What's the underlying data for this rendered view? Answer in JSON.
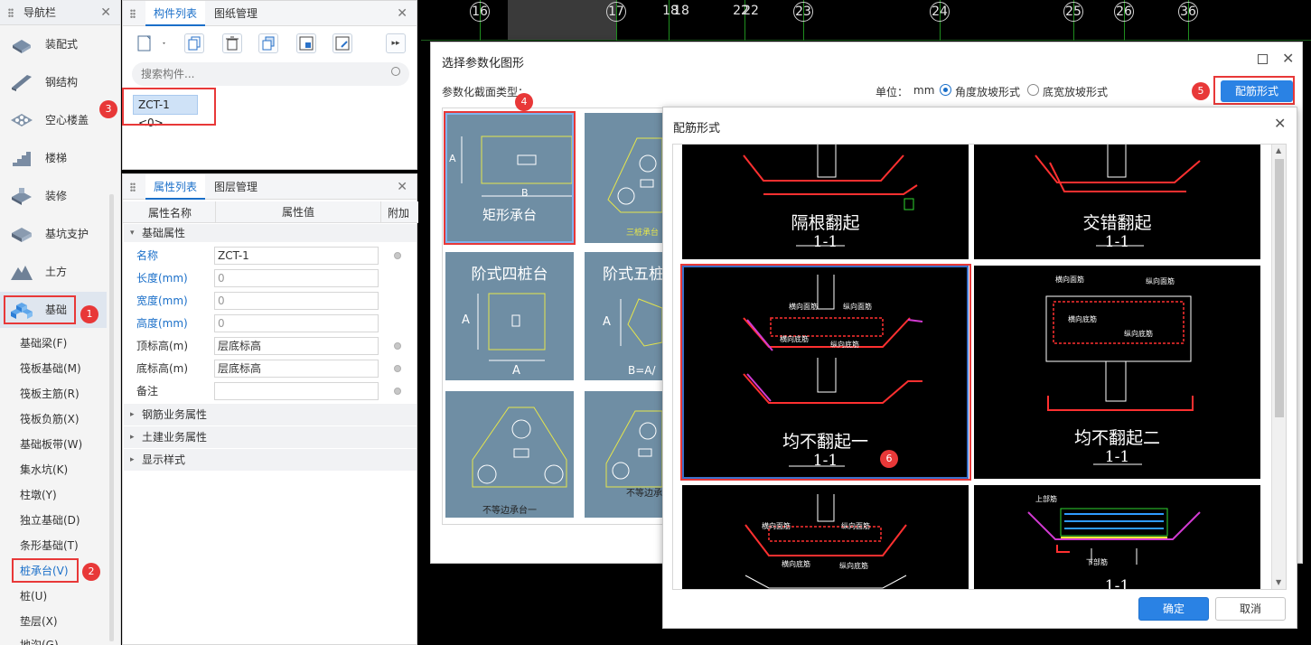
{
  "nav": {
    "title": "导航栏",
    "categories": [
      "装配式",
      "钢结构",
      "空心楼盖",
      "楼梯",
      "装修",
      "基坑支护",
      "土方",
      "基础"
    ],
    "subitems": [
      "基础梁(F)",
      "筏板基础(M)",
      "筏板主筋(R)",
      "筏板负筋(X)",
      "基础板带(W)",
      "集水坑(K)",
      "柱墩(Y)",
      "独立基础(D)",
      "条形基础(T)",
      "桩承台(V)",
      "桩(U)",
      "垫层(X)",
      "地沟(G)"
    ]
  },
  "component_panel": {
    "tabs": [
      "构件列表",
      "图纸管理"
    ],
    "search_placeholder": "搜索构件...",
    "item": "ZCT-1 <0>"
  },
  "property_panel": {
    "tabs": [
      "属性列表",
      "图层管理"
    ],
    "headers": [
      "属性名称",
      "属性值",
      "附加"
    ],
    "group_basic": "基础属性",
    "rows": [
      {
        "name": "名称",
        "value": "ZCT-1"
      },
      {
        "name": "长度(mm)",
        "value": "0"
      },
      {
        "name": "宽度(mm)",
        "value": "0"
      },
      {
        "name": "高度(mm)",
        "value": "0"
      },
      {
        "name": "顶标高(m)",
        "value": "层底标高"
      },
      {
        "name": "底标高(m)",
        "value": "层底标高"
      },
      {
        "name": "备注",
        "value": ""
      }
    ],
    "groups": [
      "钢筋业务属性",
      "土建业务属性",
      "显示样式"
    ]
  },
  "axis_numbers": [
    "16",
    "17",
    "18",
    "18",
    "22",
    "22",
    "23",
    "24",
    "25",
    "26",
    "36"
  ],
  "dialog_select": {
    "title": "选择参数化图形",
    "section_label": "参数化截面类型：",
    "unit_label": "单位：",
    "unit_value": "mm",
    "radio_angle": "角度放坡形式",
    "radio_width": "底宽放坡形式",
    "rebar_button": "配筋形式",
    "thumbs": [
      "矩形承台",
      "三桩承台",
      "阶式四桩台",
      "阶式五桩台",
      "不等边承台一",
      "不等边承台"
    ],
    "thumb_dims": {
      "a": "A",
      "b": "B",
      "ba": "B=A/"
    }
  },
  "dialog_rebar": {
    "title": "配筋形式",
    "cells": [
      {
        "name": "隔根翻起",
        "section": "1-1"
      },
      {
        "name": "交错翻起",
        "section": "1-1"
      },
      {
        "name": "均不翻起一",
        "section": "1-1"
      },
      {
        "name": "均不翻起二",
        "section": "1-1"
      },
      {
        "name": "",
        "section": ""
      },
      {
        "name": "",
        "section": "1-1"
      }
    ],
    "cad_labels": [
      "横向面筋",
      "纵向面筋",
      "横向底筋",
      "纵向底筋",
      "上部筋",
      "下部筋"
    ],
    "ok": "确定",
    "cancel": "取消"
  },
  "badges": [
    "1",
    "2",
    "3",
    "4",
    "5",
    "6"
  ],
  "colors": {
    "accent": "#1a6fc9",
    "badge": "#e83838",
    "primary_button": "#2a82e4",
    "thumb_bg": "#6f8ea4"
  }
}
